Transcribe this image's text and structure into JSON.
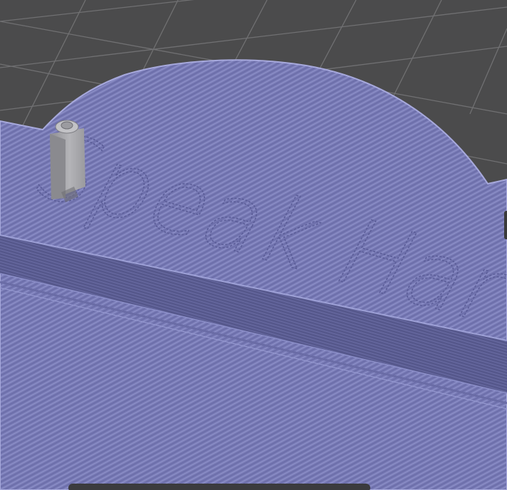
{
  "viewport": {
    "title": "",
    "background_color": "#4b4b4c",
    "bed_grid_color": "#7a7a7c"
  },
  "print": {
    "plate_color": "#7b7cb6",
    "plate_shadow_color": "#5a5b8f",
    "line_color": "#9597cc",
    "engraved_text_visible": "Speak Har",
    "object_color": "#a6a6aa"
  },
  "scrollbar": {
    "visible": true
  }
}
